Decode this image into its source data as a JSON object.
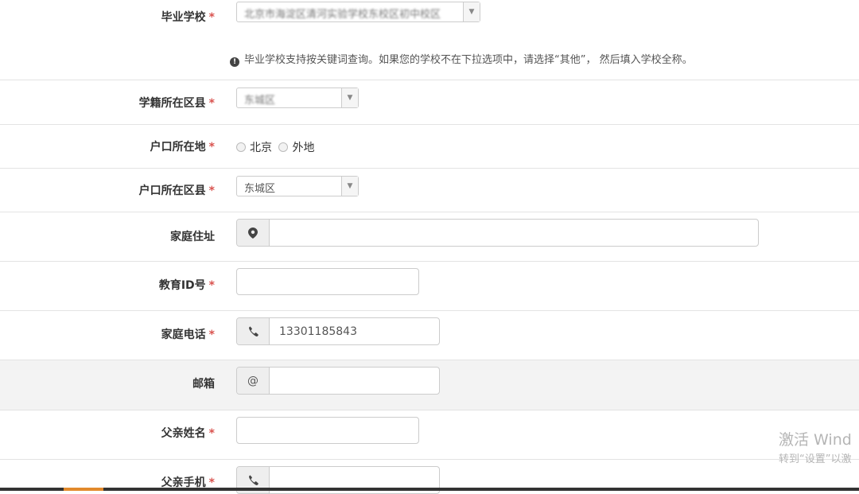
{
  "fields": {
    "school": {
      "label": "毕业学校",
      "required": "*",
      "value": "北京市海淀区清河实验学校东校区初中校区"
    },
    "school_hint": {
      "icon": "info-icon",
      "text": "毕业学校支持按关键词查询。如果您的学校不在下拉选项中，请选择“其他”， 然后填入学校全称。"
    },
    "school_district": {
      "label": "学籍所在区县",
      "required": "*",
      "value": "东城区"
    },
    "household": {
      "label": "户口所在地",
      "required": "*",
      "options": [
        "北京",
        "外地"
      ]
    },
    "household_district": {
      "label": "户口所在区县",
      "required": "*",
      "value": "东城区"
    },
    "address": {
      "label": "家庭住址",
      "icon": "map-marker-icon",
      "value": ""
    },
    "edu_id": {
      "label": "教育ID号",
      "required": "*",
      "value": ""
    },
    "home_phone": {
      "label": "家庭电话",
      "required": "*",
      "icon": "phone-icon",
      "value": "13301185843"
    },
    "email": {
      "label": "邮箱",
      "icon_text": "@",
      "value": ""
    },
    "father_name": {
      "label": "父亲姓名",
      "required": "*",
      "value": ""
    },
    "father_mobile": {
      "label": "父亲手机",
      "required": "*",
      "icon": "phone-icon",
      "value": ""
    }
  },
  "caret": "▼",
  "watermark": {
    "line1": "激活 Wind",
    "line2": "转到“设置”以激"
  },
  "colors": {
    "required": "#d9534f",
    "addon_bg": "#eeeeee",
    "shaded_row": "#f3f3f3",
    "taskbar_accent": "#e28a2c"
  }
}
